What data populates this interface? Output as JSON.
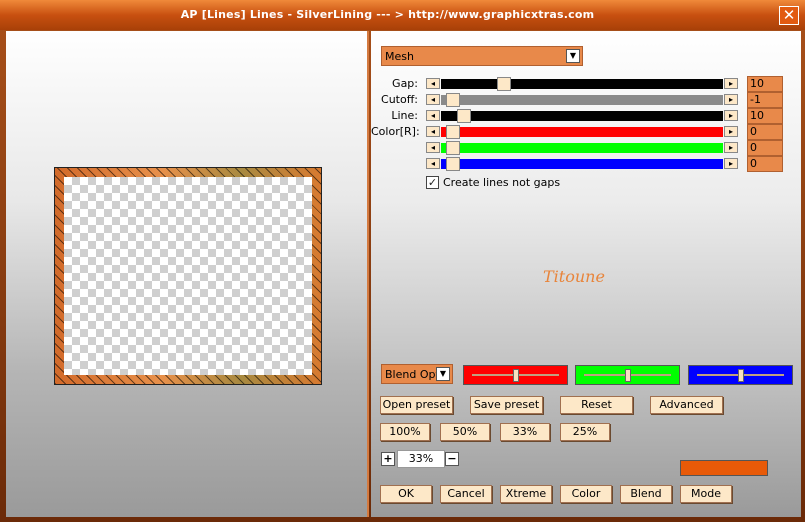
{
  "window": {
    "title": "AP [Lines]  Lines - SilverLining    --- > http://www.graphicxtras.com",
    "close_glyph": "✕"
  },
  "mode": {
    "selected": "Mesh"
  },
  "sliders": [
    {
      "label": "Gap:",
      "value": "10",
      "track_color": "#000000",
      "fraction": 0.21
    },
    {
      "label": "Cutoff:",
      "value": "-1",
      "track_color": "#8a8a8a",
      "fraction": 0.02
    },
    {
      "label": "Line:",
      "value": "10",
      "track_color": "#000000",
      "fraction": 0.06
    },
    {
      "label": "Color[R]:",
      "value": "0",
      "track_color": "#ff0000",
      "fraction": 0.02
    },
    {
      "label": "",
      "value": "0",
      "track_color": "#00ff00",
      "fraction": 0.02
    },
    {
      "label": "",
      "value": "0",
      "track_color": "#0000ff",
      "fraction": 0.02
    }
  ],
  "create_lines": {
    "label": "Create lines not gaps",
    "checked": true,
    "check_glyph": "✓"
  },
  "signature": "Titoune",
  "blend": {
    "selected": "Blend Options",
    "red": {
      "color": "#ff0000",
      "fraction": 0.5
    },
    "green": {
      "color": "#00ff00",
      "fraction": 0.5
    },
    "blue": {
      "color": "#0000ff",
      "fraction": 0.5
    }
  },
  "buttons": {
    "open_preset": "Open preset",
    "save_preset": "Save preset",
    "reset": "Reset",
    "advanced": "Advanced",
    "zoom_100": "100%",
    "zoom_50": "50%",
    "zoom_33": "33%",
    "zoom_25": "25%",
    "ok": "OK",
    "cancel": "Cancel",
    "xtreme": "Xtreme",
    "color": "Color",
    "blend": "Blend",
    "mode": "Mode"
  },
  "zoom": {
    "value": "33%",
    "plus": "+",
    "minus": "−"
  },
  "color_swatch": "#e85a08",
  "glyphs": {
    "left_arrow": "◂",
    "right_arrow": "▸",
    "dropdown": "▼"
  }
}
